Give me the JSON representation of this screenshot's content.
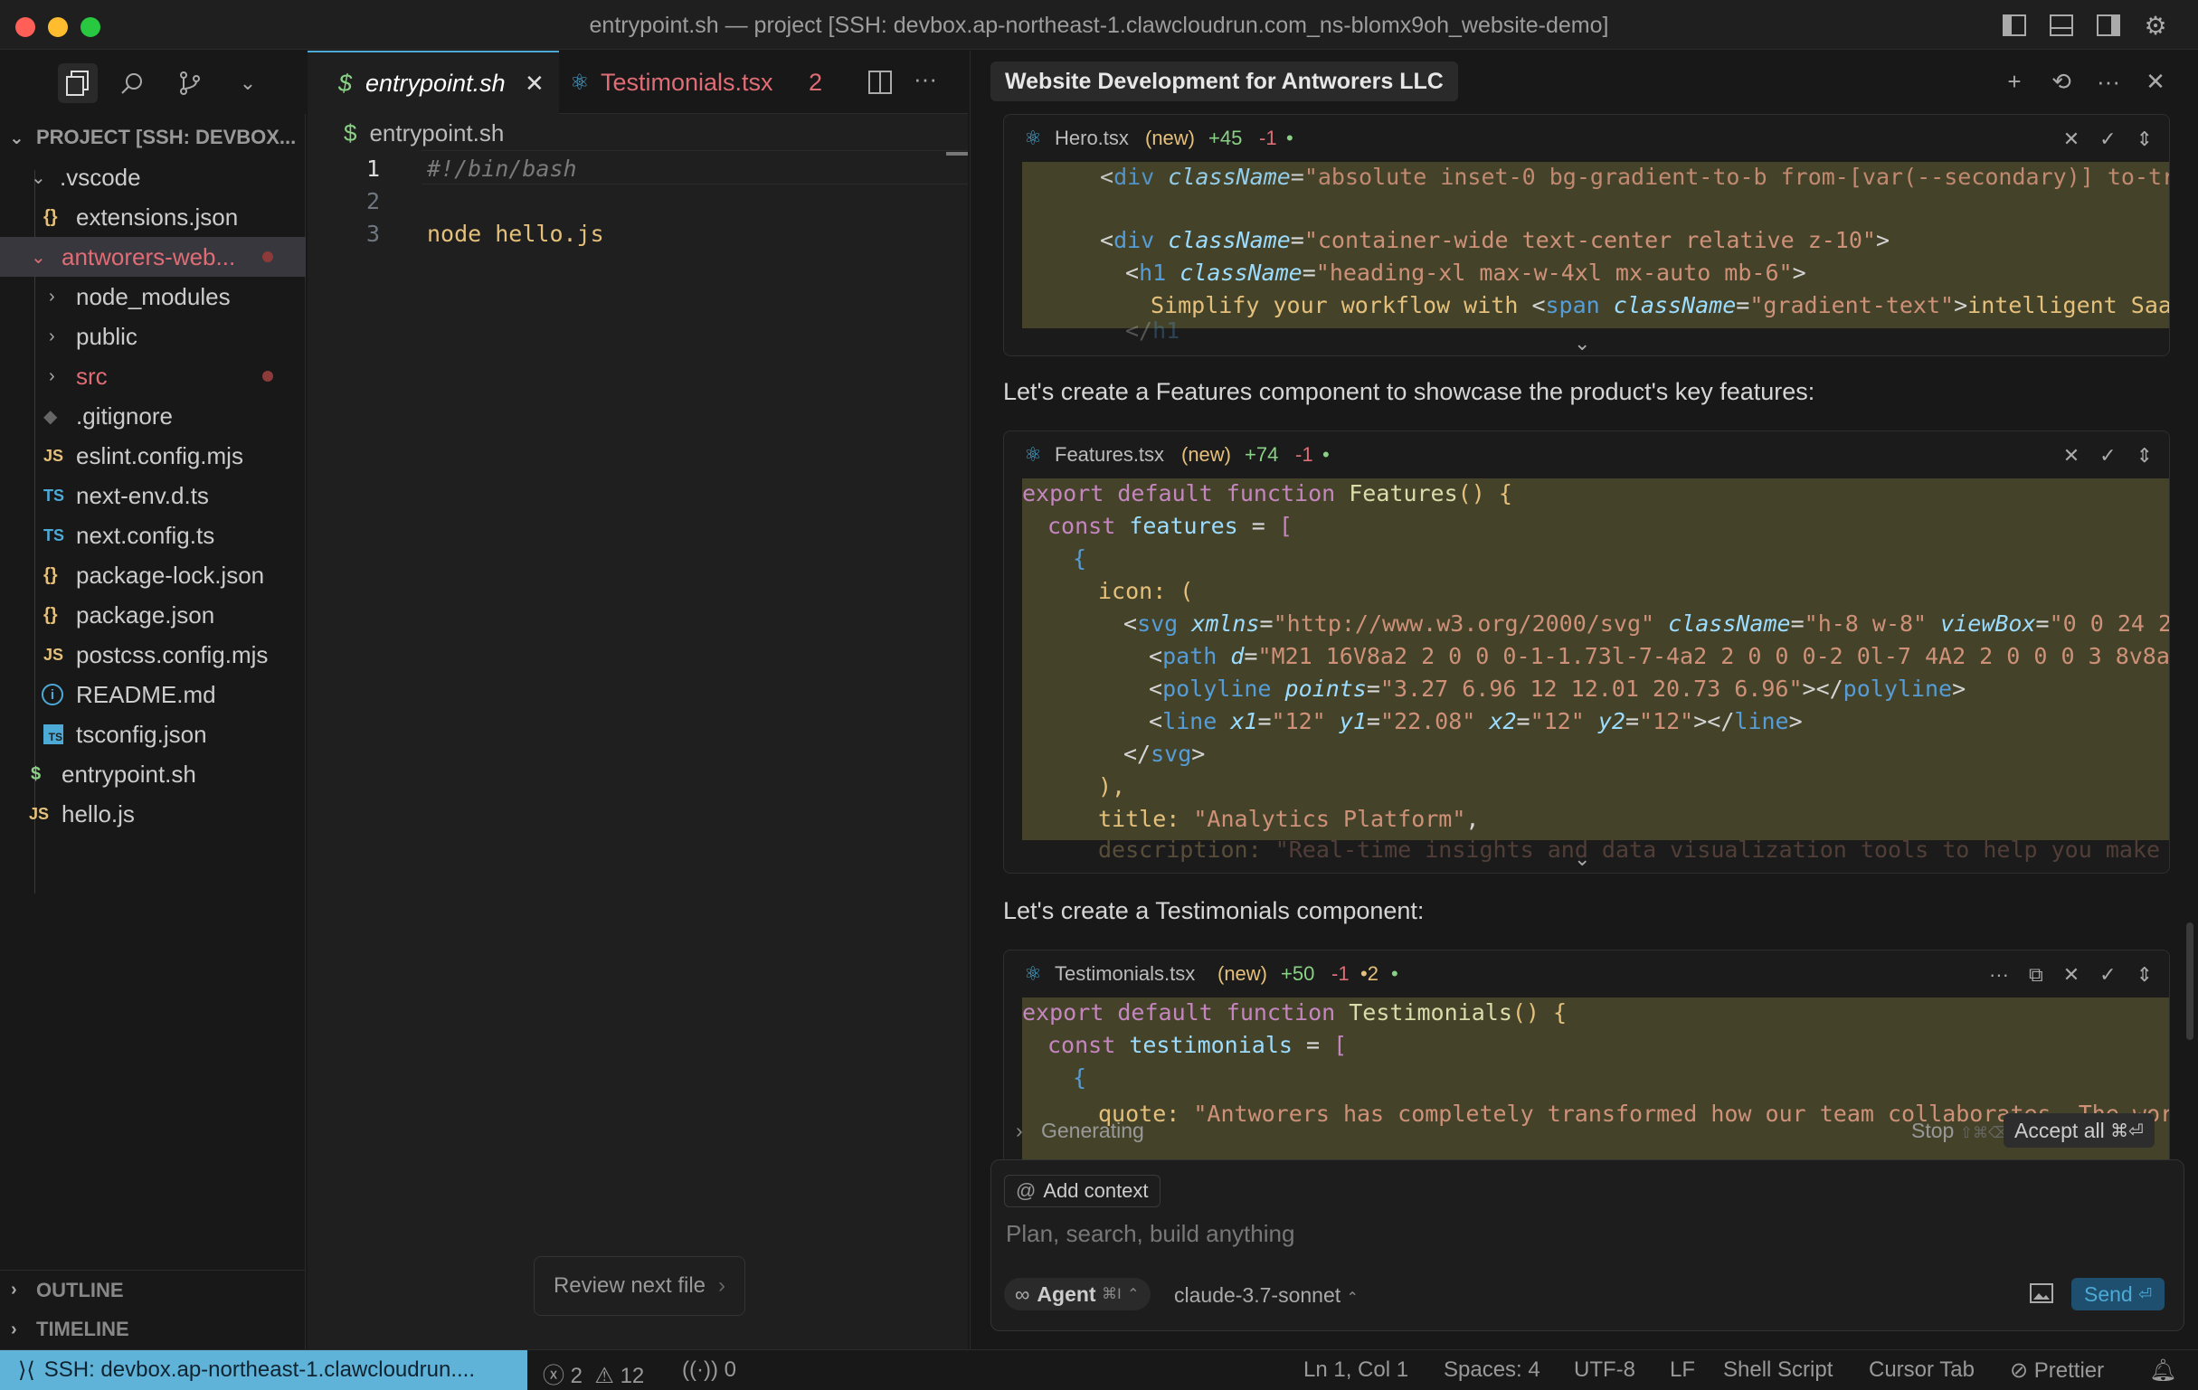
{
  "window": {
    "title": "entrypoint.sh — project [SSH: devbox.ap-northeast-1.clawcloudrun.com_ns-blomx9oh_website-demo]"
  },
  "explorer": {
    "project_label": "PROJECT [SSH: DEVBOX...",
    "items": [
      {
        "label": ".vscode",
        "icon": "chevron-down"
      },
      {
        "label": "extensions.json",
        "icon": "{}"
      },
      {
        "label": "antworers-web...",
        "icon": "chevron-down"
      },
      {
        "label": "node_modules",
        "icon": "chevron-right"
      },
      {
        "label": "public",
        "icon": "chevron-right"
      },
      {
        "label": "src",
        "icon": "chevron-right"
      },
      {
        "label": ".gitignore",
        "icon": "git"
      },
      {
        "label": "eslint.config.mjs",
        "icon": "JS"
      },
      {
        "label": "next-env.d.ts",
        "icon": "TS"
      },
      {
        "label": "next.config.ts",
        "icon": "TS"
      },
      {
        "label": "package-lock.json",
        "icon": "{}"
      },
      {
        "label": "package.json",
        "icon": "{}"
      },
      {
        "label": "postcss.config.mjs",
        "icon": "JS"
      },
      {
        "label": "README.md",
        "icon": "i"
      },
      {
        "label": "tsconfig.json",
        "icon": "TS"
      },
      {
        "label": "entrypoint.sh",
        "icon": "$"
      },
      {
        "label": "hello.js",
        "icon": "JS"
      }
    ],
    "outline": "OUTLINE",
    "timeline": "TIMELINE"
  },
  "editor": {
    "tabs": [
      {
        "label": "entrypoint.sh",
        "icon": "$"
      },
      {
        "label": "Testimonials.tsx",
        "badge": "2"
      }
    ],
    "breadcrumb": "entrypoint.sh",
    "lines": [
      {
        "n": "1",
        "text": "#!/bin/bash"
      },
      {
        "n": "2",
        "text": ""
      },
      {
        "n": "3",
        "text": "node hello.js"
      }
    ],
    "review_button": "Review next file"
  },
  "chat": {
    "title": "Website Development for Antworers LLC",
    "blocks": [
      {
        "file": "Hero.tsx",
        "status": "(new)",
        "added": "+45",
        "removed": "-1"
      },
      {
        "file": "Features.tsx",
        "status": "(new)",
        "added": "+74",
        "removed": "-1"
      },
      {
        "file": "Testimonials.tsx",
        "status": "(new)",
        "added": "+50",
        "removed": "-1",
        "errors": "2"
      }
    ],
    "messages": [
      "Let's create a Features component to showcase the product's key features:",
      "Let's create a Testimonials component:"
    ],
    "generating": "Generating",
    "stop": "Stop",
    "stop_shortcut": "⇧⌘⌫",
    "accept_all": "Accept all",
    "accept_shortcut": "⌘⏎",
    "add_context": "Add context",
    "placeholder": "Plan, search, build anything",
    "mode": "Agent",
    "mode_shortcut": "⌘I",
    "model": "claude-3.7-sonnet",
    "send": "Send"
  },
  "status": {
    "remote": "SSH: devbox.ap-northeast-1.clawcloudrun....",
    "errors": "2",
    "warnings": "12",
    "ports": "0",
    "position": "Ln 1, Col 1",
    "spaces": "Spaces: 4",
    "encoding": "UTF-8",
    "eol": "LF",
    "language": "Shell Script",
    "cursor_tab": "Cursor Tab",
    "prettier": "Prettier"
  },
  "colors": {
    "accent": "#4da9d6",
    "modified": "#e06c75",
    "diff_bg": "#44432a",
    "remote_bg": "#5fb3d9"
  }
}
